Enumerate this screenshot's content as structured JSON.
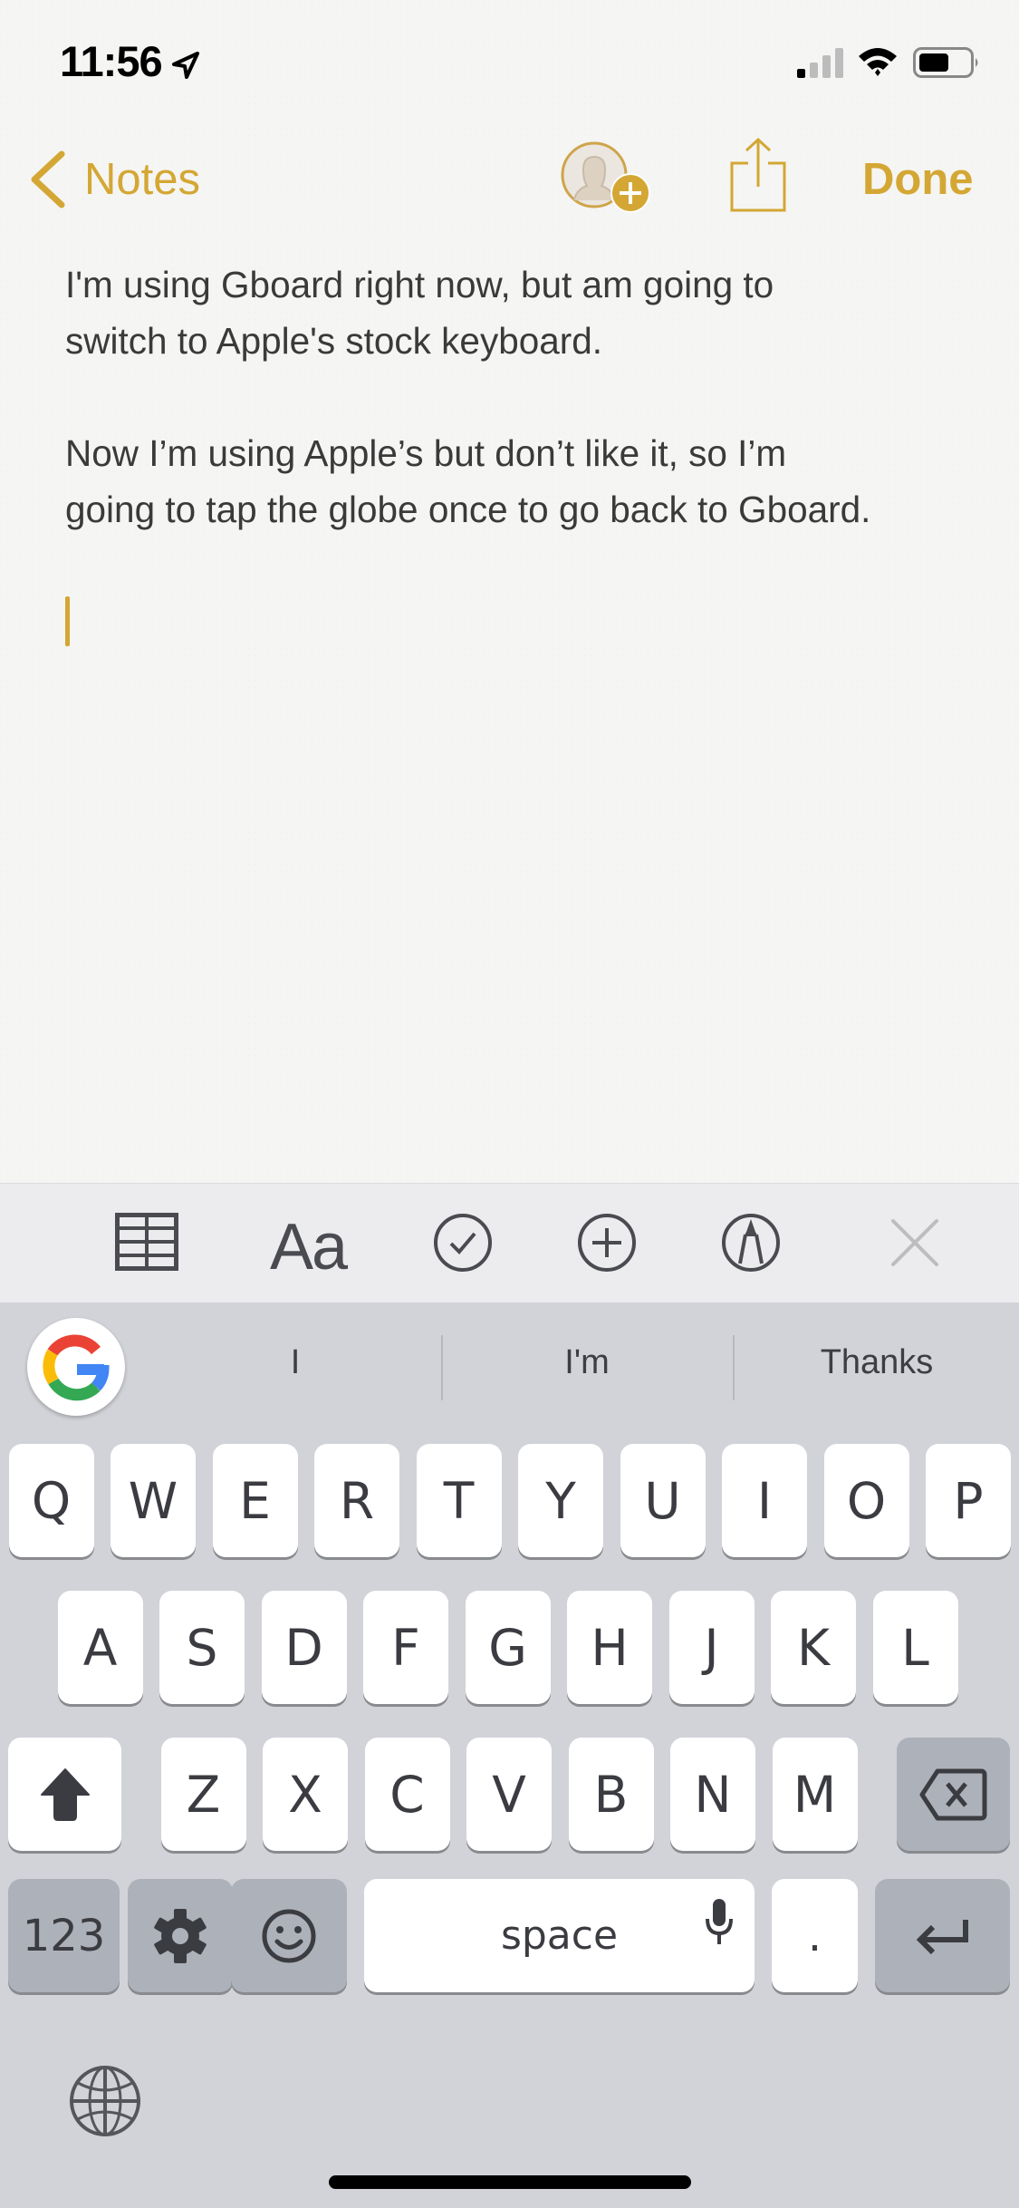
{
  "status_bar": {
    "time": "11:56",
    "location_icon": "location-arrow-icon",
    "signal_bars_active": 1,
    "signal_bars_total": 4,
    "wifi_icon": "wifi-icon",
    "battery_level_fraction": 0.6
  },
  "nav": {
    "back_label": "Notes",
    "add_people_icon": "add-person-icon",
    "share_icon": "share-icon",
    "done_label": "Done"
  },
  "note": {
    "paragraphs": [
      {
        "lines": [
          "I'm using Gboard right now, but am going to",
          "switch to Apple's stock keyboard."
        ]
      },
      {
        "lines": [
          "Now I’m using Apple’s but don’t like it, so I’m",
          "going to tap the globe once to go back to Gboard."
        ]
      }
    ]
  },
  "toolbar": {
    "table_icon": "table-icon",
    "format_label": "Aa",
    "checklist_icon": "checklist-icon",
    "add_icon": "plus-circle-icon",
    "markup_icon": "markup-pen-icon",
    "close_icon": "close-icon"
  },
  "keyboard": {
    "suggestions": [
      "I",
      "I'm",
      "Thanks"
    ],
    "row1": [
      "Q",
      "W",
      "E",
      "R",
      "T",
      "Y",
      "U",
      "I",
      "O",
      "P"
    ],
    "row2": [
      "A",
      "S",
      "D",
      "F",
      "G",
      "H",
      "J",
      "K",
      "L"
    ],
    "row3": [
      "Z",
      "X",
      "C",
      "V",
      "B",
      "N",
      "M"
    ],
    "numbers_label": "123",
    "space_label": "space",
    "period_label": ".",
    "colors": {
      "accent_gold": "#d4a734",
      "key_white": "#ffffff",
      "key_dark": "#adb1b9",
      "keyboard_bg": "#d1d3d8",
      "google_blue": "#4285f4",
      "google_red": "#ea4335",
      "google_yellow": "#fbbc05",
      "google_green": "#34a853"
    }
  }
}
